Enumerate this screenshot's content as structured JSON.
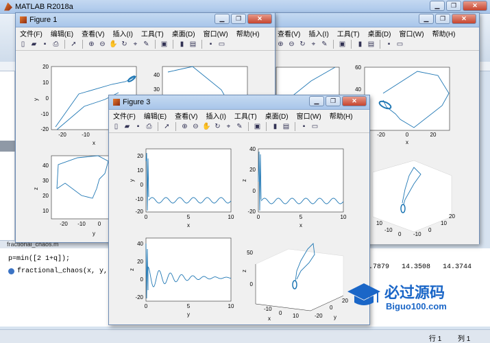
{
  "app": {
    "title": "MATLAB R2018a",
    "command_line": "p=min([2 1+q]);",
    "func_hint": "fractional_chaos(x, y, z)",
    "file_tab": "fractional_chaos.m",
    "values_readout": ".7879   14.3508   14.3744",
    "status_row_label": "行 1",
    "status_col_label": "列 1"
  },
  "figure_menu": [
    "文件(F)",
    "编辑(E)",
    "查看(V)",
    "插入(I)",
    "工具(T)",
    "桌面(D)",
    "窗口(W)",
    "帮助(H)"
  ],
  "fig1": {
    "title": "Figure 1",
    "ax1": {
      "xlabel": "x",
      "ylabel": "y",
      "yticks": [
        "20",
        "10",
        "0",
        "-10",
        "-20"
      ],
      "xticks": [
        "-20",
        "-10"
      ]
    },
    "ax3": {
      "xlabel": "y",
      "ylabel": "z",
      "yticks": [
        "40",
        "30",
        "20",
        "10"
      ],
      "xticks": [
        "-20",
        "-10",
        "0"
      ]
    },
    "ax2": {
      "yticks": [
        "40",
        "30",
        "20"
      ]
    }
  },
  "fig2": {
    "ax_top": {
      "xlabel": "x",
      "ylabel": "z",
      "yticks": [
        "60",
        "40",
        "20"
      ],
      "xticks": [
        "-20",
        "0",
        "20"
      ]
    },
    "ax_3d": {
      "ticks": [
        "-10",
        "0",
        "10",
        "-20",
        "-10",
        "0",
        "10",
        "20"
      ]
    }
  },
  "fig3": {
    "title": "Figure 3",
    "ax1": {
      "xlabel": "x",
      "ylabel": "y",
      "yticks": [
        "20",
        "10",
        "0",
        "-10",
        "-20"
      ],
      "xticks": [
        "0",
        "5",
        "10"
      ]
    },
    "ax2": {
      "xlabel": "x",
      "ylabel": "z",
      "yticks": [
        "40",
        "20",
        "0",
        "-20"
      ],
      "xticks": [
        "0",
        "5",
        "10"
      ]
    },
    "ax3": {
      "xlabel": "y",
      "ylabel": "z",
      "yticks": [
        "40",
        "20",
        "0",
        "-20"
      ],
      "xticks": [
        "0",
        "5",
        "10"
      ]
    },
    "ax4": {
      "xlabel": "x",
      "ylabel": "y",
      "zlabel": "z",
      "zticks": [
        "50",
        "0"
      ],
      "xticks": [
        "-10",
        "0",
        "10"
      ],
      "yticks": [
        "-20",
        "0",
        "20"
      ]
    }
  },
  "watermark": {
    "cn": "必过源码",
    "url": "Biguo100.com"
  },
  "colors": {
    "line": "#1f77b4",
    "window_bg": "#f0f0f0",
    "title_grad": "#b7cfec"
  }
}
